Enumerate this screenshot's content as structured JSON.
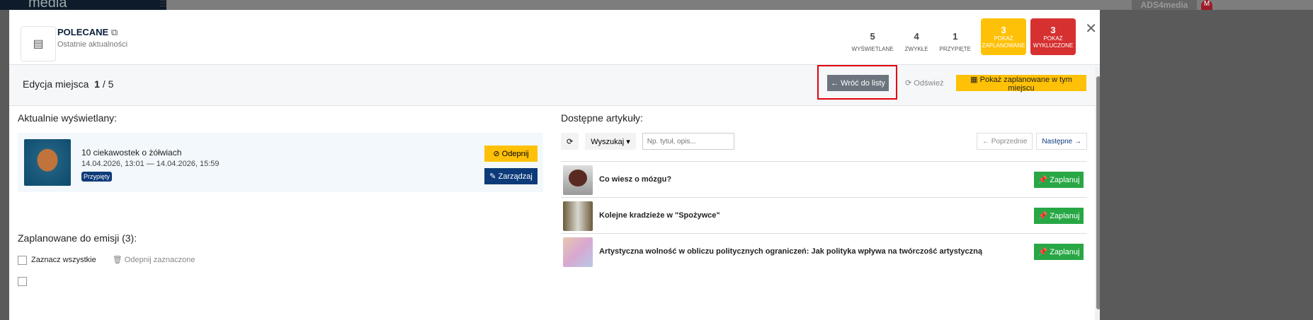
{
  "app": {
    "logo": "media",
    "account": "ADS4media",
    "avatar": "M"
  },
  "header": {
    "title": "POLECANE",
    "subtitle": "Ostatnie aktualności",
    "stats": [
      {
        "value": "5",
        "label": "WYŚWIETLANE"
      },
      {
        "value": "4",
        "label": "ZWYKŁE"
      },
      {
        "value": "1",
        "label": "PRZYPIĘTE"
      }
    ],
    "scheduled": {
      "value": "3",
      "label": "POKAŻ ZAPLANOWANE",
      "color": "#ffc107"
    },
    "excluded": {
      "value": "3",
      "label": "POKAŻ WYKLUCZONE",
      "color": "#d63031"
    }
  },
  "toolbar": {
    "edit_label": "Edycja miejsca",
    "current": "1",
    "total": "/ 5",
    "back": "← Wróć do listy",
    "refresh": "Odśwież",
    "show_scheduled": "Pokaż zaplanowane w tym miejscu"
  },
  "current": {
    "heading": "Aktualnie wyświetlany:",
    "title": "10 ciekawostek o żółwiach",
    "dates": "14.04.2026, 13:01 — 14.04.2026, 15:59",
    "badge": "Przypięty",
    "unpin": "Odepnij",
    "manage": "Zarządzaj"
  },
  "scheduled_section": {
    "heading": "Zaplanowane do emisji (3):",
    "select_all": "Zaznacz wszystkie",
    "unpin_selected": "Odepnij zaznaczone"
  },
  "available": {
    "heading": "Dostępne artykuły:",
    "search_mode": "Wyszukaj",
    "search_placeholder": "Np. tytuł, opis...",
    "prev": "← Poprzednie",
    "next": "Następne →",
    "articles": [
      {
        "title": "Co wiesz o mózgu?",
        "action": "Zaplanuj"
      },
      {
        "title": "Kolejne kradzieże w \"Spożywce\"",
        "action": "Zaplanuj"
      },
      {
        "title": "Artystyczna wolność w obliczu politycznych ograniczeń: Jak polityka wpływa na twórczość artystyczną",
        "action": "Zaplanuj"
      }
    ]
  }
}
